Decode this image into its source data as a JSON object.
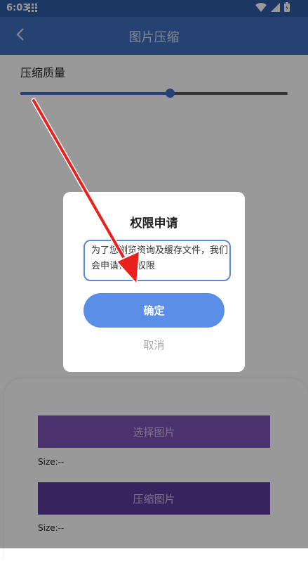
{
  "status_bar": {
    "time": "6:03",
    "icons": [
      "grid-icon",
      "wifi-icon",
      "signal-icon",
      "battery-icon"
    ]
  },
  "app_bar": {
    "title": "图片压缩",
    "back_icon": "chevron-left-icon"
  },
  "quality": {
    "label": "压缩质量",
    "value_fraction": 0.56
  },
  "actions": {
    "select_label": "选择图片",
    "select_size": "Size:--",
    "compress_label": "压缩图片",
    "compress_size": "Size:--"
  },
  "dialog": {
    "title": "权限申请",
    "message": "为了您浏览资询及缓存文件，我们会申请存储权限",
    "confirm_label": "确定",
    "cancel_label": "取消"
  },
  "colors": {
    "status_bar": "#2f5ca6",
    "app_bar": "#3f6fbe",
    "confirm": "#5b8ee6",
    "select_button": "#7d54b8",
    "compress_button": "#5c3b9b",
    "arrow": "#e8201e"
  }
}
